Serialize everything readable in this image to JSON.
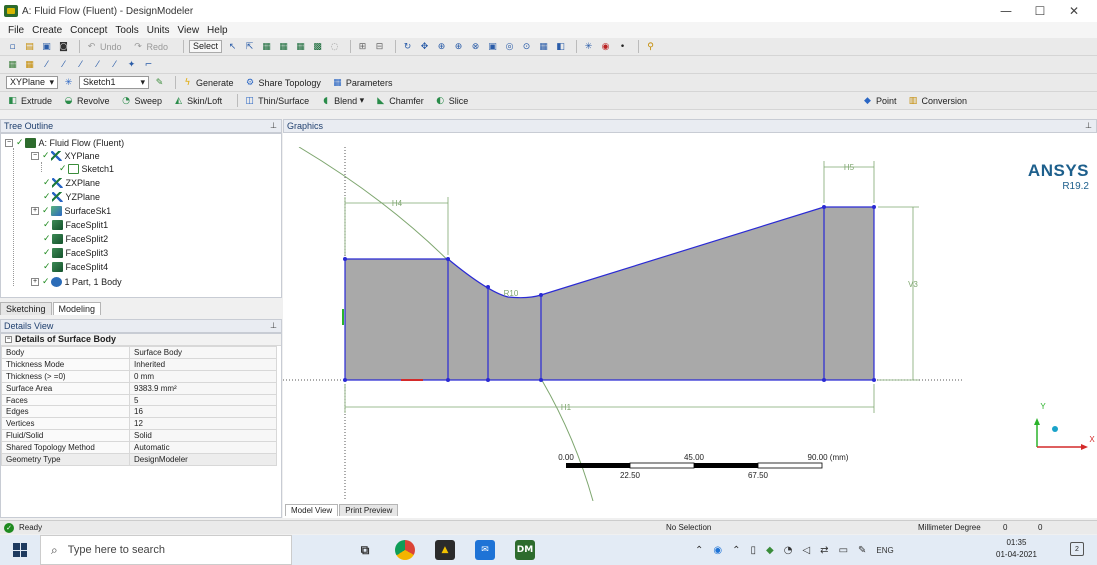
{
  "window": {
    "title": "A: Fluid Flow (Fluent) - DesignModeler",
    "controls": [
      "—",
      "☐",
      "✕"
    ]
  },
  "menu": [
    "File",
    "Create",
    "Concept",
    "Tools",
    "Units",
    "View",
    "Help"
  ],
  "toolbar1": {
    "undo": "Undo",
    "redo": "Redo",
    "select": "Select"
  },
  "toolbar3": {
    "plane": "XYPlane",
    "sketch": "Sketch1",
    "generate": "Generate",
    "share_topology": "Share Topology",
    "parameters": "Parameters"
  },
  "toolbar4": {
    "extrude": "Extrude",
    "revolve": "Revolve",
    "sweep": "Sweep",
    "skin_loft": "Skin/Loft",
    "thin_surface": "Thin/Surface",
    "blend": "Blend",
    "chamfer": "Chamfer",
    "slice": "Slice",
    "point": "Point",
    "conversion": "Conversion"
  },
  "tree": {
    "header": "Tree Outline",
    "items": [
      "A: Fluid Flow (Fluent)",
      "XYPlane",
      "Sketch1",
      "ZXPlane",
      "YZPlane",
      "SurfaceSk1",
      "FaceSplit1",
      "FaceSplit2",
      "FaceSplit3",
      "FaceSplit4",
      "1 Part, 1 Body"
    ]
  },
  "tabs": {
    "sketching": "Sketching",
    "modeling": "Modeling"
  },
  "details": {
    "header": "Details View",
    "group": "Details of Surface Body",
    "rows": [
      {
        "key": "Body",
        "value": "Surface Body"
      },
      {
        "key": "Thickness Mode",
        "value": "Inherited"
      },
      {
        "key": "Thickness (> =0)",
        "value": "0 mm"
      },
      {
        "key": "Surface Area",
        "value": "9383.9 mm²"
      },
      {
        "key": "Faces",
        "value": "5"
      },
      {
        "key": "Edges",
        "value": "16"
      },
      {
        "key": "Vertices",
        "value": "12"
      },
      {
        "key": "Fluid/Solid",
        "value": "Solid"
      },
      {
        "key": "Shared Topology Method",
        "value": "Automatic"
      },
      {
        "key": "Geometry Type",
        "value": "DesignModeler"
      }
    ]
  },
  "graphics": {
    "header": "Graphics",
    "logo": "ANSYS",
    "version": "R19.2",
    "dims": {
      "h4": "H4",
      "h5": "H5",
      "v3": "V3",
      "r10": "R10",
      "h1": "H1"
    },
    "scale": {
      "top": [
        "0.00",
        "45.00",
        "90.00 (mm)"
      ],
      "bottom": [
        "22.50",
        "67.50"
      ]
    },
    "axes": {
      "x": "X",
      "y": "Y"
    },
    "bottom_tabs": [
      "Model View",
      "Print Preview"
    ]
  },
  "status": {
    "state": "Ready",
    "selection": "No Selection",
    "units": "Millimeter  Degree",
    "n1": "0",
    "n2": "0"
  },
  "taskbar": {
    "search_placeholder": "Type here to search",
    "apps": [
      "task-view",
      "chrome",
      "ansys-workbench",
      "mail",
      "designmodeler"
    ],
    "app_dm_label": "DM",
    "lang": "ENG",
    "time": "01:35",
    "date": "01-04-2021",
    "notif": "2"
  },
  "colors": {
    "accent": "#1d5f8c",
    "geometry_fill": "#a9a9a9",
    "geometry_edge": "#2a2ad4",
    "construction": "#7ea66f"
  }
}
